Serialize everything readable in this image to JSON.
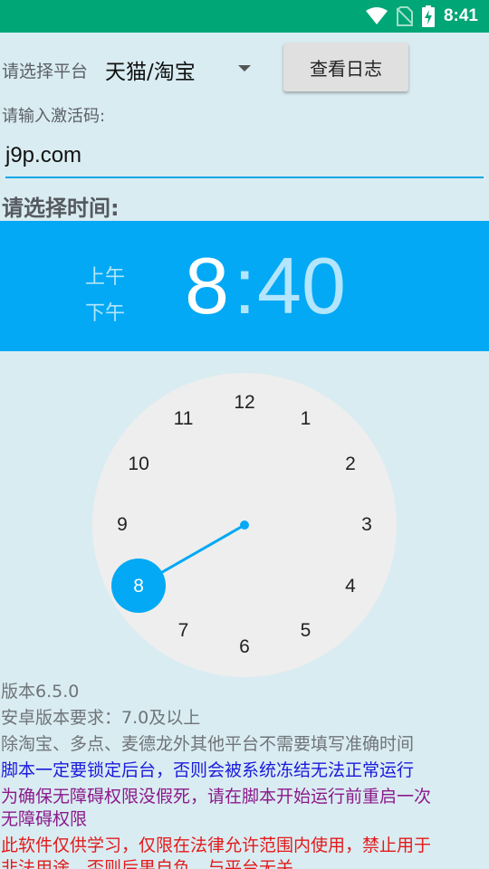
{
  "status_bar": {
    "time": "8:41",
    "icons": [
      "wifi-icon",
      "no-sim-icon",
      "battery-charging-icon"
    ]
  },
  "platform": {
    "label": "请选择平台",
    "selected": "天猫/淘宝"
  },
  "view_log_button": "查看日志",
  "activation": {
    "label": "请输入激活码:",
    "value": "j9p.com"
  },
  "time_label": "请选择时间:",
  "time_picker": {
    "am_label": "上午",
    "pm_label": "下午",
    "hour": "8",
    "separator": ":",
    "minute": "40",
    "selected_mode": "hour",
    "clock_numbers": [
      "12",
      "1",
      "2",
      "3",
      "4",
      "5",
      "6",
      "7",
      "8",
      "9",
      "10",
      "11"
    ],
    "selected_number": "8"
  },
  "info_lines": [
    {
      "text": "版本6.5.0",
      "color": "#6f7478"
    },
    {
      "text": "安卓版本要求：7.0及以上",
      "color": "#6f7478"
    },
    {
      "text": "除淘宝、多点、麦德龙外其他平台不需要填写准确时间",
      "color": "#6f7478"
    },
    {
      "text": "脚本一定要锁定后台，否则会被系统冻结无法正常运行",
      "color": "#1a1adb"
    },
    {
      "text": "为确保无障碍权限没假死，请在脚本开始运行前重启一次",
      "color": "#8b1a8b"
    },
    {
      "text": "无障碍权限",
      "color": "#8b1a8b"
    },
    {
      "text": "此软件仅供学习，仅限在法律允许范围内使用，禁止用于",
      "color": "#e31a1a"
    },
    {
      "text": "非法用途，否则后果自负，与平台无关",
      "color": "#e31a1a"
    }
  ],
  "colors": {
    "status_bar": "#00a676",
    "accent": "#03a9f4",
    "background": "#d9ecf2"
  }
}
